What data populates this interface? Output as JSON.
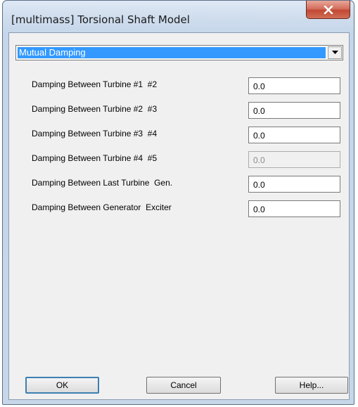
{
  "window": {
    "title": "[multimass] Torsional Shaft Model"
  },
  "combo": {
    "selected": "Mutual Damping"
  },
  "rows": [
    {
      "label": "Damping Between Turbine #1  #2",
      "value": "0.0",
      "enabled": true
    },
    {
      "label": "Damping Between Turbine #2  #3",
      "value": "0.0",
      "enabled": true
    },
    {
      "label": "Damping Between Turbine #3  #4",
      "value": "0.0",
      "enabled": true
    },
    {
      "label": "Damping Between Turbine #4  #5",
      "value": "0.0",
      "enabled": false
    },
    {
      "label": "Damping Between Last Turbine  Gen.",
      "value": "0.0",
      "enabled": true
    },
    {
      "label": "Damping Between Generator  Exciter",
      "value": "0.0",
      "enabled": true
    }
  ],
  "buttons": {
    "ok": "OK",
    "cancel": "Cancel",
    "help": "Help..."
  },
  "icons": {
    "close": "close-icon",
    "dropdown": "chevron-down-icon"
  },
  "colors": {
    "selection": "#3399ff",
    "close_button": "#c24934"
  }
}
